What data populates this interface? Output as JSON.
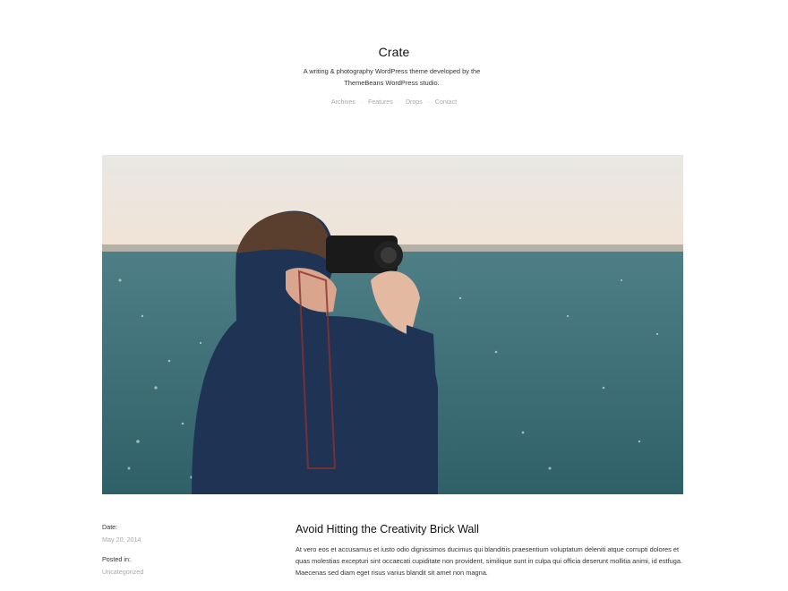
{
  "header": {
    "title": "Crate",
    "description": "A writing & photography WordPress theme developed by the ThemeBeans WordPress studio.",
    "nav": [
      "Archives",
      "Features",
      "Drops",
      "Contact"
    ],
    "nav_separator": "·"
  },
  "hero": {
    "alt": "Man in a blue suit taking a photo by the water"
  },
  "meta": {
    "date_label": "Date:",
    "date_value": "May 20, 2014",
    "posted_label": "Posted in:",
    "posted_value": "Uncategorized"
  },
  "post": {
    "title": "Avoid Hitting the Creativity Brick Wall",
    "excerpt": "At vero eos et accusamus et iusto odio dignissimos ducimus qui blanditiis praesentium voluptatum deleniti atque corrupti dolores et quas molestias excepturi sint occaecati cupiditate non provident, similique sunt in culpa qui officia deserunt mollitia animi, id estfuga. Maecenas sed diam eget risus varius blandit sit amet non magna."
  },
  "colors": {
    "text": "#222222",
    "muted": "#a8a8a8",
    "sky": "#ece4dc",
    "sea": "#3e6e75",
    "suit": "#1f3454"
  }
}
